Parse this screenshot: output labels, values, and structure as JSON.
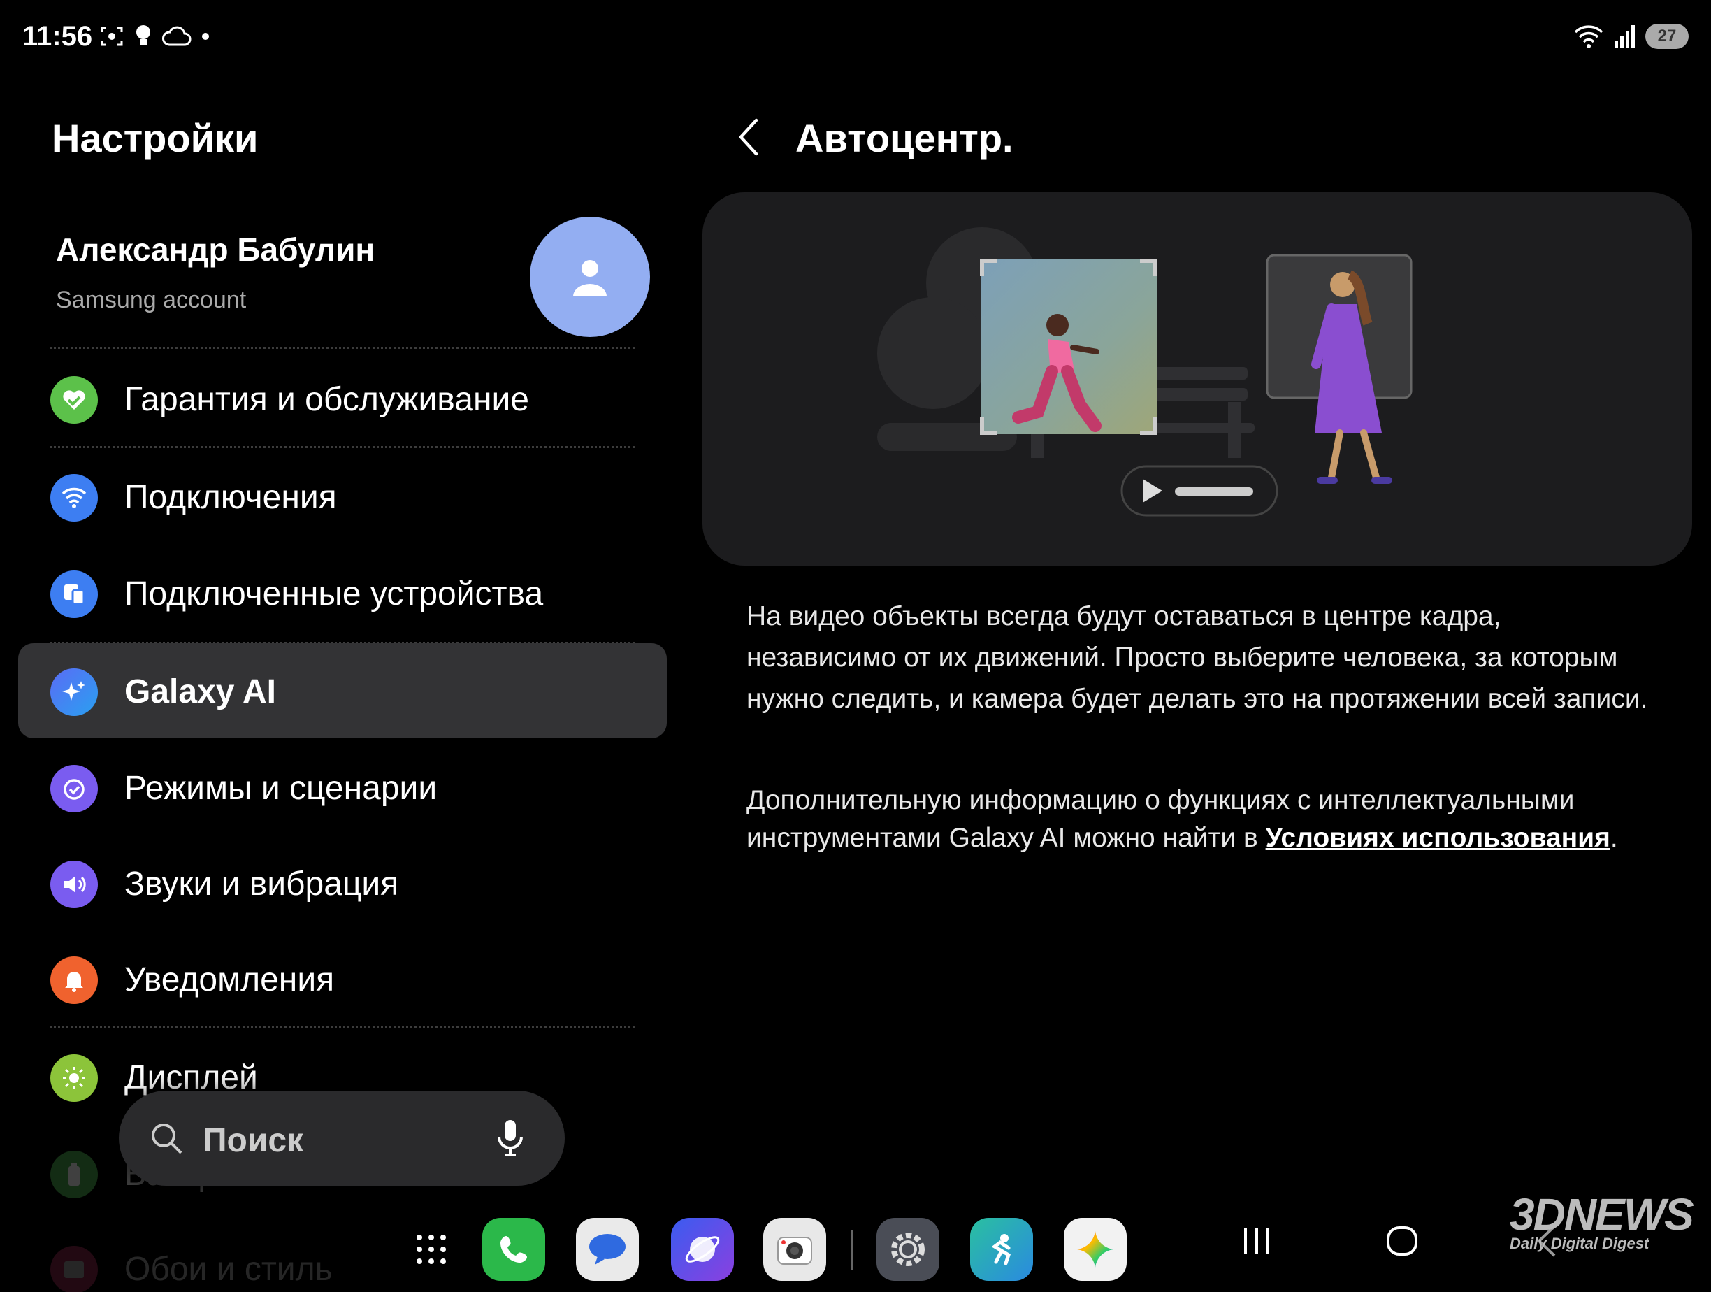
{
  "status_bar": {
    "time": "11:56",
    "left_icons": [
      "screenshot-icon",
      "bulb-icon",
      "cloud-icon",
      "dot-icon"
    ],
    "right_icons": [
      "wifi-icon",
      "signal-icon"
    ],
    "battery": "27"
  },
  "left": {
    "title": "Настройки",
    "account": {
      "name": "Александр Бабулин",
      "subtitle": "Samsung account"
    },
    "items": [
      {
        "label": "Гарантия и обслуживание",
        "icon": "heart-icon",
        "color": "#5cc14a"
      },
      {
        "label": "Подключения",
        "icon": "wifi-icon",
        "color": "#3d7ef2"
      },
      {
        "label": "Подключенные устройства",
        "icon": "devices-icon",
        "color": "#3d7ef2"
      },
      {
        "label": "Galaxy AI",
        "icon": "sparkle-icon",
        "color": "#3d7ef2"
      },
      {
        "label": "Режимы и сценарии",
        "icon": "modes-icon",
        "color": "#7a5cf0"
      },
      {
        "label": "Звуки и вибрация",
        "icon": "sound-icon",
        "color": "#7a5cf0"
      },
      {
        "label": "Уведомления",
        "icon": "bell-icon",
        "color": "#f0622e"
      },
      {
        "label": "Дисплей",
        "icon": "sun-icon",
        "color": "#8cc43a"
      },
      {
        "label": "Батарея",
        "icon": "battery-icon",
        "color": "#4caf50"
      },
      {
        "label": "Обои и стиль",
        "icon": "wallpaper-icon",
        "color": "#e0407a"
      }
    ],
    "search": {
      "placeholder": "Поиск"
    }
  },
  "right": {
    "title": "Автоцентр.",
    "description": "На видео объекты всегда будут оставаться в центре кадра, независимо от их движений. Просто выберите человека, за которым нужно следить, и камера будет делать это на протяжении всей записи.",
    "info_prefix": "Дополнительную информацию о функциях с интеллектуальными инструментами Galaxy AI можно найти в ",
    "info_link": "Условиях использования",
    "info_suffix": "."
  },
  "dock": {
    "apps": [
      "apps-grid-icon",
      "phone-icon",
      "messages-icon",
      "internet-icon",
      "camera-icon",
      "settings-icon",
      "fitness-icon",
      "gemini-icon"
    ],
    "nav": [
      "recents-icon",
      "home-icon",
      "back-icon"
    ]
  },
  "watermark": {
    "logo": "3DNEWS",
    "tagline": "Daily Digital Digest"
  }
}
